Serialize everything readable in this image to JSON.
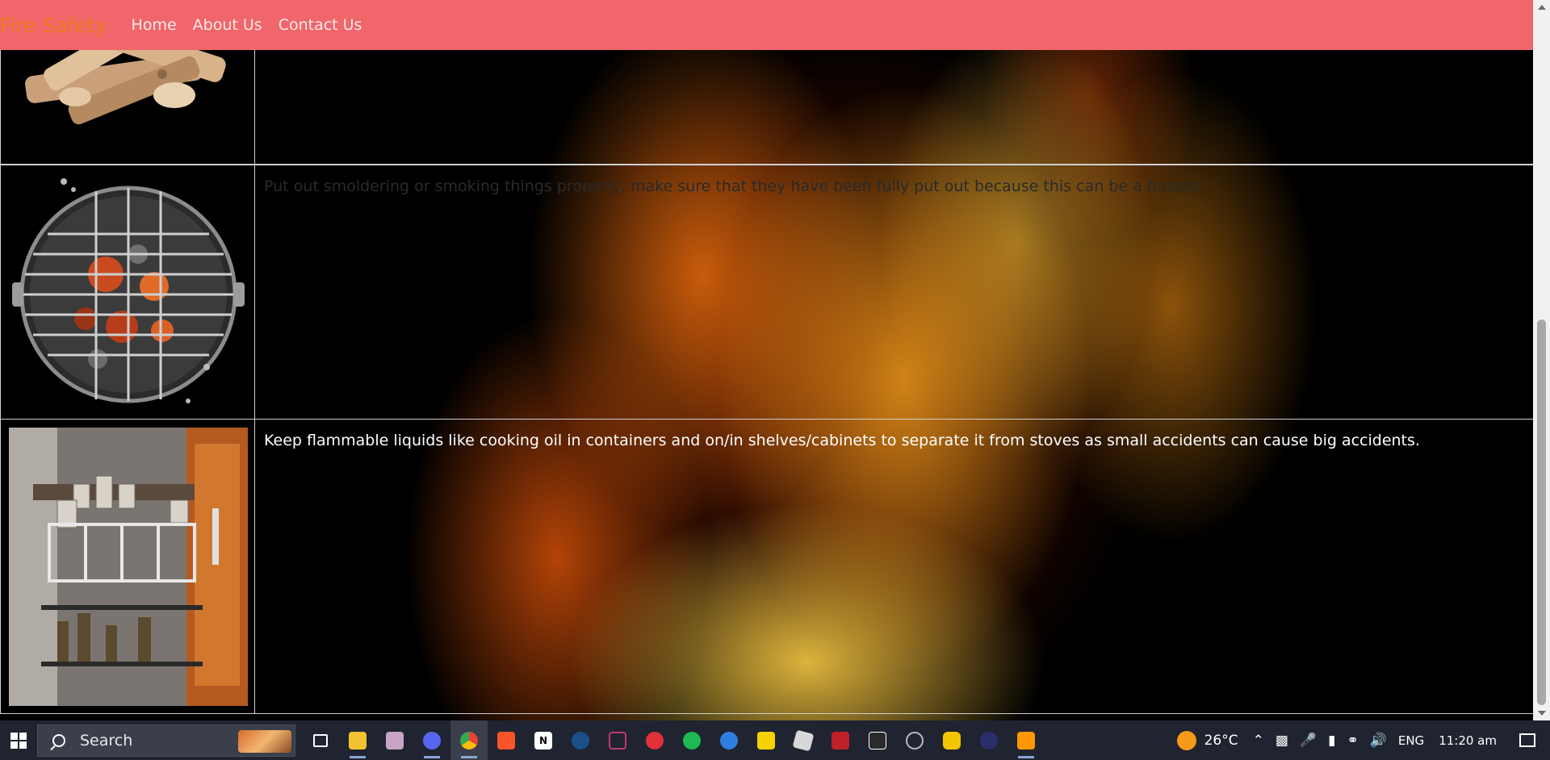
{
  "navbar": {
    "brand": "Fire Safety",
    "links": [
      "Home",
      "About Us",
      "Contact Us"
    ],
    "background": "#f0666a",
    "brand_color": "#f07a20"
  },
  "rows": [
    {
      "image": "firewood-logs-image",
      "text": ""
    },
    {
      "image": "charcoal-grill-image",
      "text": "Put out smoldering or smoking things properly, make sure that they have been fully put out because this can be a hazard."
    },
    {
      "image": "kitchen-cabinet-bottles-image",
      "text": "Keep flammable liquids like cooking oil in containers and on/in shelves/cabinets to separate it from stoves as small accidents can cause big accidents."
    }
  ],
  "taskbar": {
    "search_placeholder": "Search",
    "apps": [
      "task-view-icon",
      "file-explorer-icon",
      "photos-icon",
      "discord-icon",
      "chrome-icon",
      "brave-icon",
      "notion-icon",
      "steam-icon",
      "vscode-icon",
      "game-icon",
      "spotify-icon",
      "remote-icon",
      "sticky-notes-icon",
      "roblox-icon",
      "voicemeeter-icon",
      "epic-games-icon",
      "obs-icon",
      "spotify-lyrics-icon",
      "app-icon",
      "sublime-icon"
    ],
    "temperature": "26°C",
    "language": "ENG",
    "time": "11:20 am"
  }
}
